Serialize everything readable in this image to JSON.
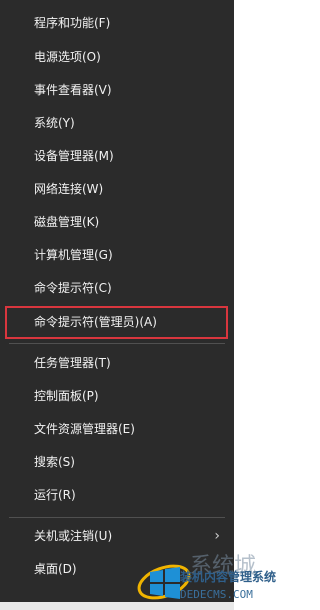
{
  "menu": {
    "items": [
      {
        "label": "程序和功能(F)"
      },
      {
        "label": "电源选项(O)"
      },
      {
        "label": "事件查看器(V)"
      },
      {
        "label": "系统(Y)"
      },
      {
        "label": "设备管理器(M)"
      },
      {
        "label": "网络连接(W)"
      },
      {
        "label": "磁盘管理(K)"
      },
      {
        "label": "计算机管理(G)"
      },
      {
        "label": "命令提示符(C)"
      },
      {
        "label": "命令提示符(管理员)(A)"
      },
      {
        "label": "任务管理器(T)"
      },
      {
        "label": "控制面板(P)"
      },
      {
        "label": "文件资源管理器(E)"
      },
      {
        "label": "搜索(S)"
      },
      {
        "label": "运行(R)"
      },
      {
        "label": "关机或注销(U)"
      },
      {
        "label": "桌面(D)"
      }
    ],
    "highlighted_item": "命令提示符(管理员)(A)",
    "highlight_color": "#d9363e",
    "background_color": "#2b2b2b",
    "submenu_icon": "chevron-right-icon"
  },
  "watermark": {
    "brand_text": "系统城",
    "tagline": "装机内容管理系统",
    "url": "DEDECMS.COM"
  }
}
